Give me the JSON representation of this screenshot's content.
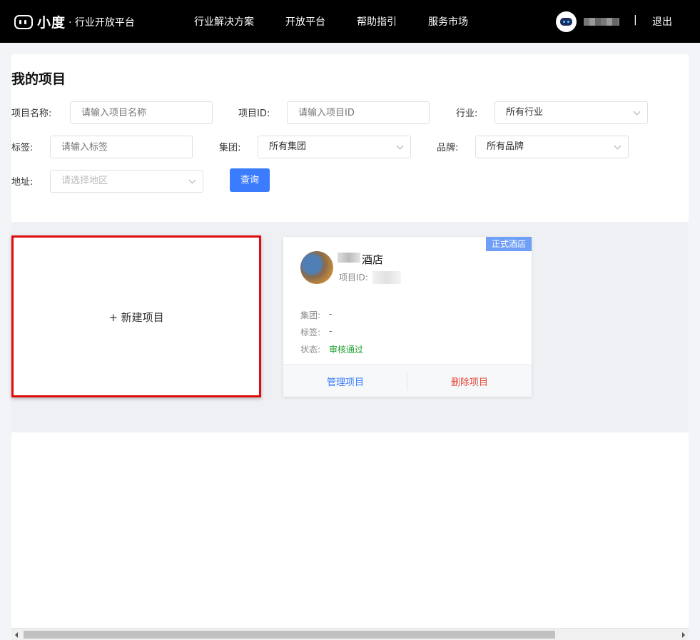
{
  "header": {
    "logo_text": "小度",
    "logo_sub": "· 行业开放平台",
    "nav": [
      "行业解决方案",
      "开放平台",
      "帮助指引",
      "服务市场"
    ],
    "separator": "|",
    "logout": "退出"
  },
  "page": {
    "title": "我的项目"
  },
  "filters": {
    "project_name": {
      "label": "项目名称:",
      "placeholder": "请输入项目名称"
    },
    "project_id": {
      "label": "项目ID:",
      "placeholder": "请输入项目ID"
    },
    "industry": {
      "label": "行业:",
      "value": "所有行业"
    },
    "tag": {
      "label": "标签:",
      "placeholder": "请输入标签"
    },
    "group": {
      "label": "集团:",
      "value": "所有集团"
    },
    "brand": {
      "label": "品牌:",
      "value": "所有品牌"
    },
    "address": {
      "label": "地址:",
      "placeholder": "请选择地区"
    },
    "query_button": "查询"
  },
  "new_project": {
    "label": "+ 新建项目"
  },
  "project_card": {
    "badge": "正式酒店",
    "name": "酒店",
    "id_label": "项目ID:",
    "group_label": "集团:",
    "group_value": "-",
    "tag_label": "标签:",
    "tag_value": "-",
    "status_label": "状态:",
    "status_value": "审核通过",
    "status_color": "#1a9c2b",
    "manage": "管理项目",
    "delete": "删除项目"
  },
  "colors": {
    "accent": "#3a7cfc",
    "danger": "#e5483a",
    "highlight_border": "#dd0d0d",
    "badge": "#6f9ff7"
  }
}
